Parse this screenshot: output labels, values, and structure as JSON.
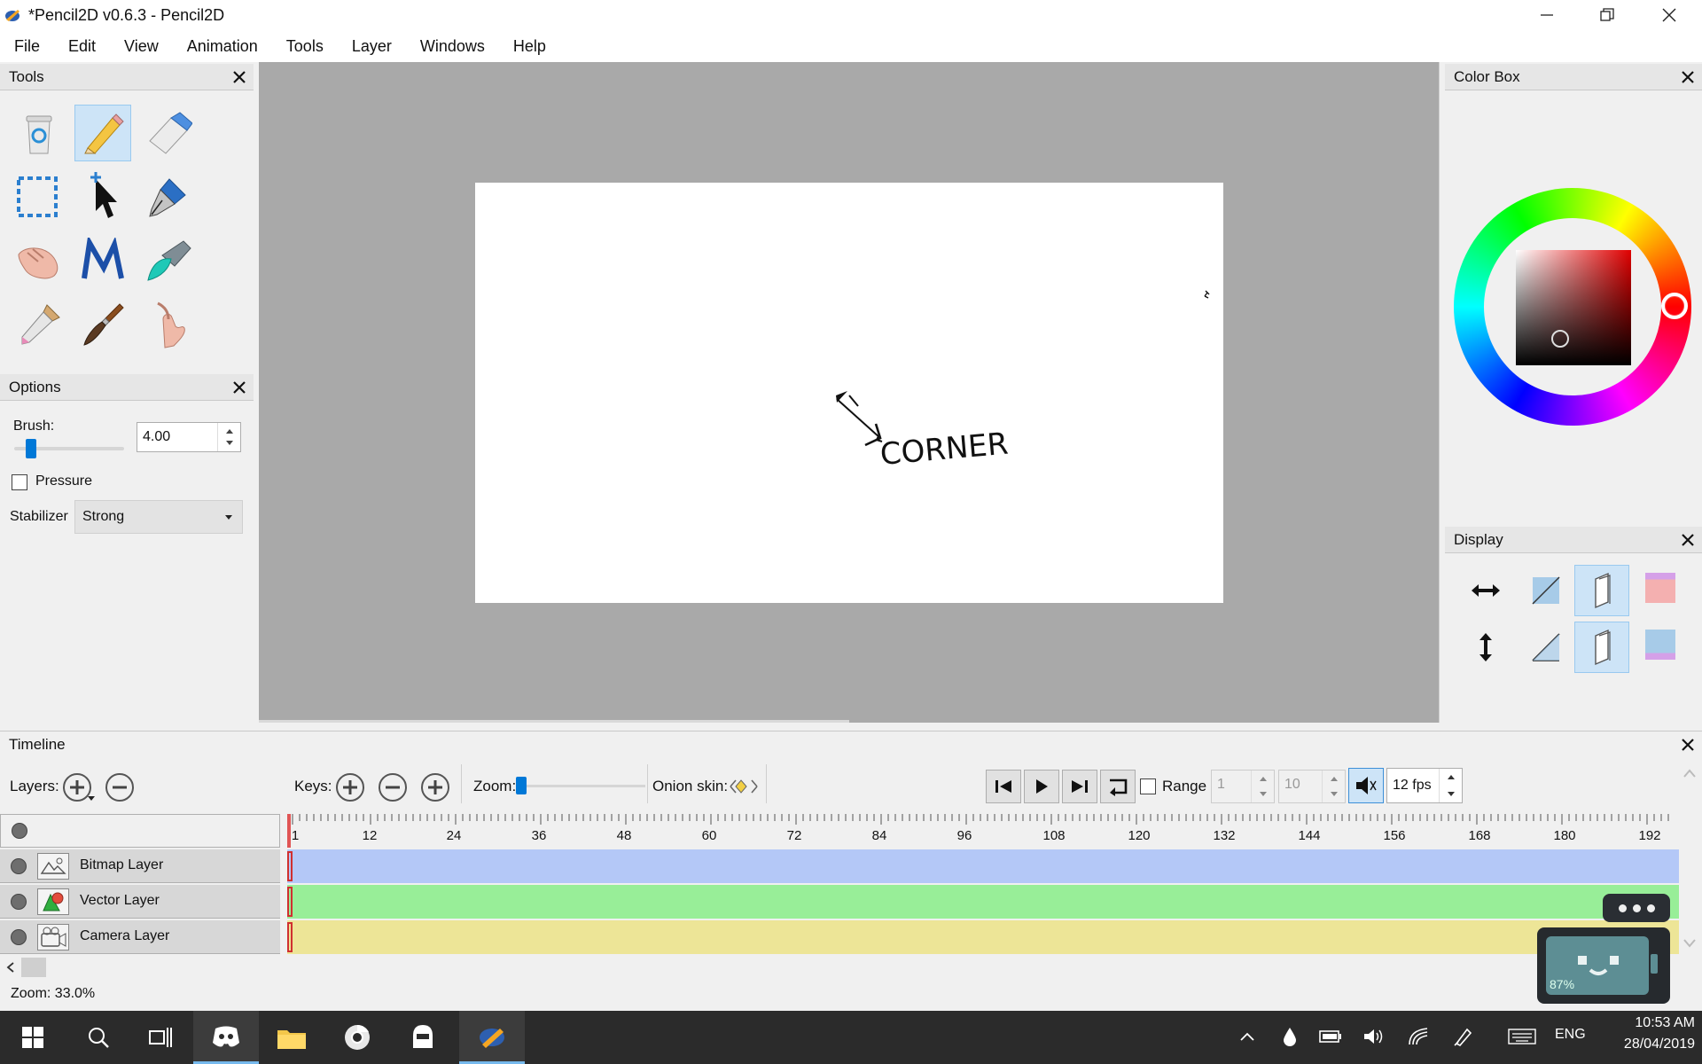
{
  "window": {
    "title": "*Pencil2D v0.6.3 - Pencil2D"
  },
  "menu": [
    "File",
    "Edit",
    "View",
    "Animation",
    "Tools",
    "Layer",
    "Windows",
    "Help"
  ],
  "tools_panel": {
    "title": "Tools",
    "tools": [
      "clear",
      "pencil",
      "eraser",
      "select",
      "move",
      "pen",
      "hand",
      "polyline",
      "bucket",
      "eyedropper",
      "brush",
      "smudge"
    ],
    "active_tool": "pencil"
  },
  "options_panel": {
    "title": "Options",
    "brush_label": "Brush:",
    "brush_value": "4.00",
    "brush_slider_fraction": 0.12,
    "pressure_label": "Pressure",
    "pressure_checked": false,
    "stabilizer_label": "Stabilizer",
    "stabilizer_value": "Strong"
  },
  "canvas": {
    "annotation_text": "CORNER"
  },
  "color_box": {
    "title": "Color Box"
  },
  "display_panel": {
    "title": "Display"
  },
  "timeline": {
    "title": "Timeline",
    "layers_label": "Layers:",
    "keys_label": "Keys:",
    "zoom_label": "Zoom:",
    "onion_label": "Onion skin:",
    "range_label": "Range",
    "range_start": "1",
    "range_end": "10",
    "fps_value": "12 fps",
    "ruler": [
      "1",
      "12",
      "24",
      "36",
      "48",
      "60",
      "72",
      "84",
      "96",
      "108",
      "120",
      "132",
      "144",
      "156",
      "168",
      "180",
      "192"
    ],
    "layers": [
      {
        "name": "Bitmap Layer",
        "color": "#b4c8f7"
      },
      {
        "name": "Vector Layer",
        "color": "#98ee98"
      },
      {
        "name": "Camera Layer",
        "color": "#ede597"
      }
    ]
  },
  "status": {
    "zoom_text": "Zoom: 33.0%"
  },
  "overlay": {
    "battery_text": "87%"
  },
  "taskbar": {
    "language": "ENG",
    "time": "10:53 AM",
    "date": "28/04/2019"
  }
}
